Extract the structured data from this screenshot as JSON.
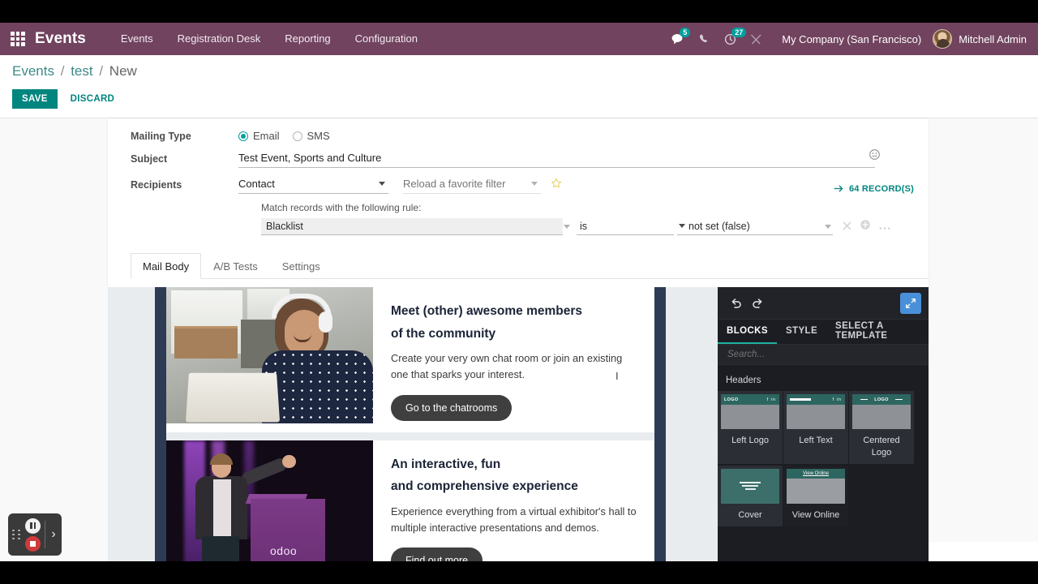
{
  "navbar": {
    "apps_icon": "apps-grid-icon",
    "brand": "Events",
    "menu": [
      {
        "label": "Events"
      },
      {
        "label": "Registration Desk"
      },
      {
        "label": "Reporting"
      },
      {
        "label": "Configuration"
      }
    ],
    "messages_icon": "chat-bubble-icon",
    "messages_count": "5",
    "phone_icon": "phone-icon",
    "activity_icon": "clock-icon",
    "activity_count": "27",
    "debug_icon": "wrench-screwdriver-icon",
    "company": "My Company (San Francisco)",
    "avatar_icon": "user-avatar",
    "user": "Mitchell Admin",
    "bg_color": "#71435f",
    "badge_color": "#00a09d"
  },
  "control_panel": {
    "breadcrumb": {
      "root": "Events",
      "parent": "test",
      "current": "New",
      "separator": "/"
    },
    "save_label": "SAVE",
    "discard_label": "DISCARD",
    "save_color": "#00857f"
  },
  "form": {
    "mailing_type": {
      "label": "Mailing Type",
      "options": [
        {
          "label": "Email",
          "selected": true
        },
        {
          "label": "SMS",
          "selected": false
        }
      ]
    },
    "subject": {
      "label": "Subject",
      "value": "Test Event, Sports and Culture",
      "emoji_icon": "smiley-icon"
    },
    "recipients": {
      "label": "Recipients",
      "value": "Contact",
      "favorite_filter_placeholder": "Reload a favorite filter",
      "star_icon": "star-icon"
    },
    "rule_hint": "Match records with the following rule:",
    "records_count": "64 RECORD(S)",
    "records_arrow_icon": "arrow-right-icon",
    "rule": {
      "field": "Blacklist",
      "operator": "is",
      "value": "not set (false)",
      "remove_icon": "close-icon",
      "add_icon": "plus-circle-icon",
      "more_icon": "ellipsis-icon"
    }
  },
  "notebook": {
    "tabs": [
      {
        "label": "Mail Body",
        "active": true
      },
      {
        "label": "A/B Tests",
        "active": false
      },
      {
        "label": "Settings",
        "active": false
      }
    ]
  },
  "mail_body": {
    "blocks": [
      {
        "image_name": "woman-with-headphones-at-laptop-photo",
        "heading_line1": "Meet (other) awesome members",
        "heading_line2": "of the community",
        "paragraph": "Create your very own chat room or join an existing one that sparks your interest.",
        "button": "Go to the chatrooms"
      },
      {
        "image_name": "speaker-on-stage-at-odoo-podium-photo",
        "heading_line1": "An interactive, fun",
        "heading_line2": "and comprehensive experience",
        "paragraph": "Experience everything from a virtual exhibitor's hall to multiple interactive presentations and demos.",
        "button": "Find out more"
      }
    ],
    "podium_logo": "odoo"
  },
  "snippet_panel": {
    "undo_icon": "undo-icon",
    "redo_icon": "redo-icon",
    "expand_icon": "expand-arrows-icon",
    "expand_color": "#4a90d9",
    "tabs": [
      {
        "label": "BLOCKS",
        "active": true
      },
      {
        "label": "STYLE",
        "active": false
      },
      {
        "label": "SELECT A TEMPLATE",
        "active": false
      }
    ],
    "active_underline_color": "#20b2a0",
    "search_placeholder": "Search...",
    "sections": [
      {
        "title": "Headers",
        "blocks": [
          {
            "label": "Left Logo",
            "thumb": "header-left-logo",
            "logo_text": "LOGO",
            "social": "f in"
          },
          {
            "label": "Left Text",
            "thumb": "header-left-text",
            "social": "f in"
          },
          {
            "label": "Centered Logo",
            "thumb": "header-centered-logo",
            "logo_text": "LOGO"
          },
          {
            "label": "Cover",
            "thumb": "cover-block"
          },
          {
            "label": "View Online",
            "thumb": "view-online-block",
            "top_text": "View Online"
          }
        ]
      }
    ]
  },
  "recorder": {
    "drag_handle_icon": "drag-dots-icon",
    "pause_icon": "pause-icon",
    "stop_icon": "stop-record-icon",
    "next_icon": "chevron-right-icon"
  }
}
